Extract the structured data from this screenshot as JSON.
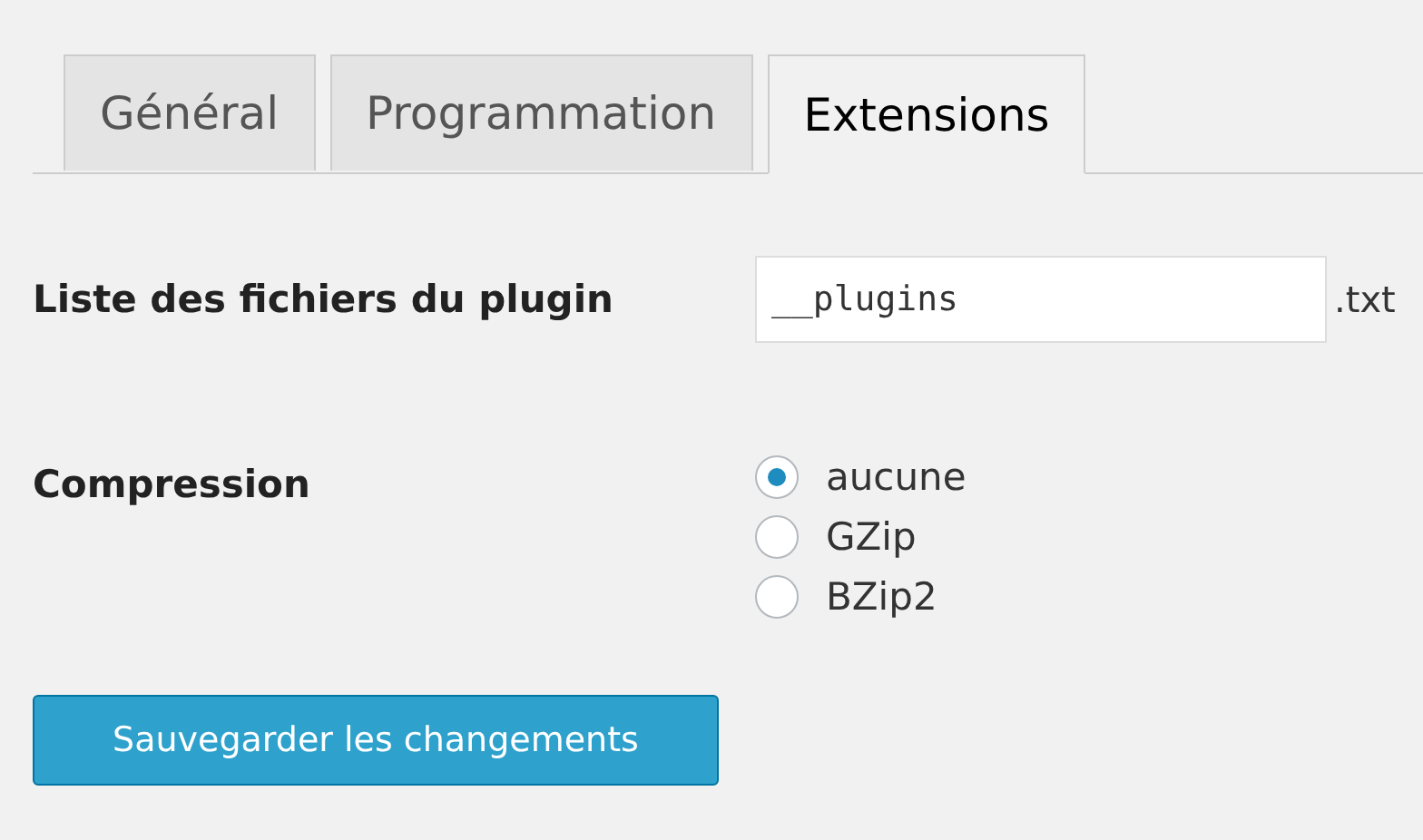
{
  "tabs": [
    {
      "label": "Général",
      "selected": false
    },
    {
      "label": "Programmation",
      "selected": false
    },
    {
      "label": "Extensions",
      "selected": true
    }
  ],
  "plugin_list": {
    "label": "Liste des fichiers du plugin",
    "value": "__plugins",
    "suffix": ".txt"
  },
  "compression": {
    "label": "Compression",
    "options": [
      {
        "label": "aucune",
        "selected": true
      },
      {
        "label": "GZip",
        "selected": false
      },
      {
        "label": "BZip2",
        "selected": false
      }
    ]
  },
  "save_button": "Sauvegarder les changements"
}
